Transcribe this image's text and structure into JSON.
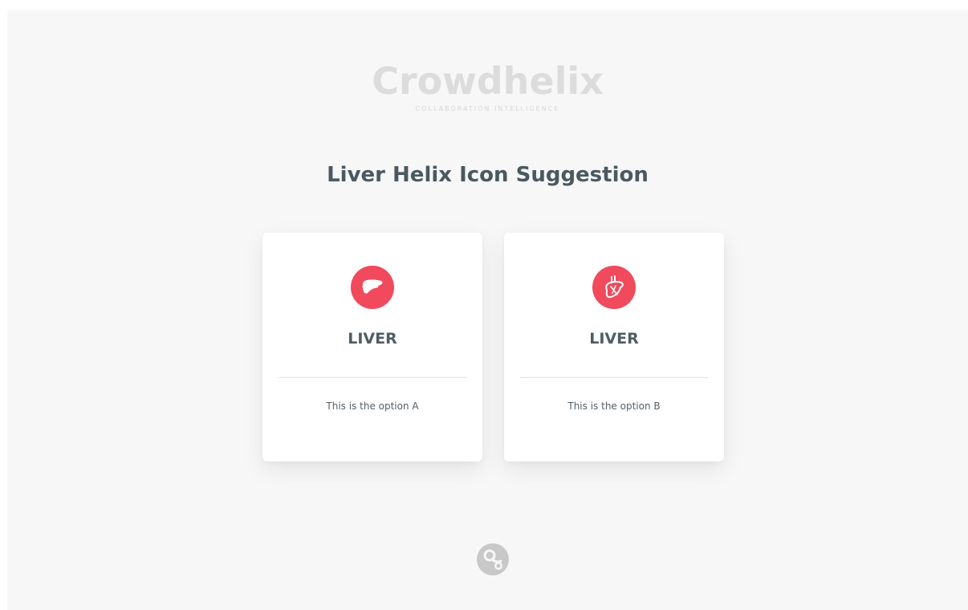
{
  "brand": {
    "name": "Crowdhelix",
    "tagline": "COLLABORATION INTELLIGENCE"
  },
  "page_title": "Liver Helix Icon Suggestion",
  "cards": [
    {
      "icon": "liver-icon",
      "title": "LIVER",
      "description": "This is the option A"
    },
    {
      "icon": "liver-gallbladder-icon",
      "title": "LIVER",
      "description": "This is the option B"
    }
  ],
  "footer": {
    "icon": "helix-logo-icon"
  },
  "colors": {
    "accent": "#f04a5c",
    "background": "#f7f7f7",
    "title_text": "#4a5960",
    "logo": "#dcdcdc"
  }
}
